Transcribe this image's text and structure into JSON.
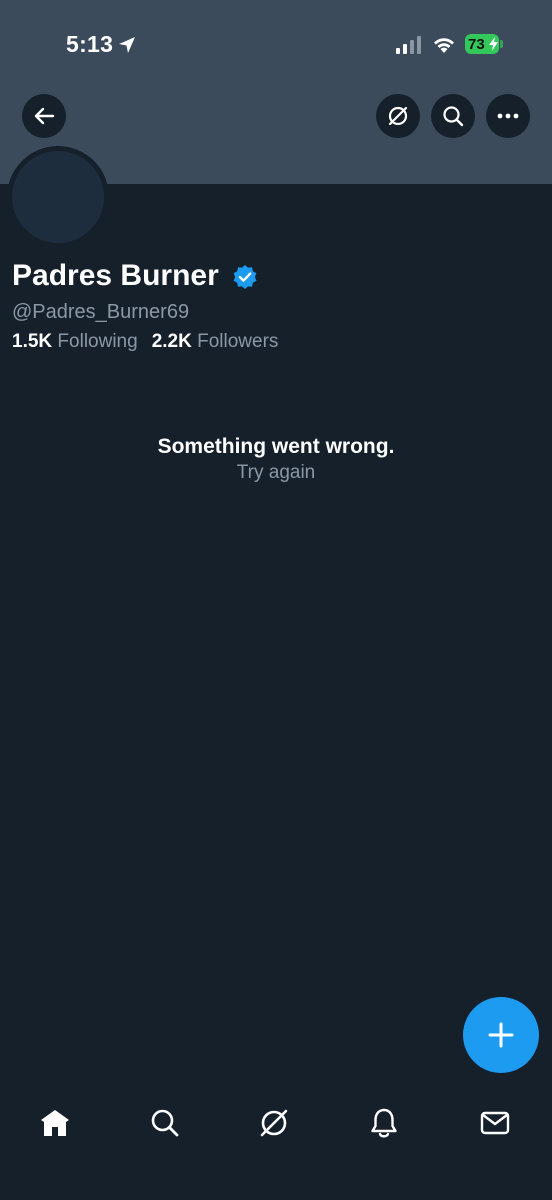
{
  "status_bar": {
    "time": "5:13",
    "battery": "73",
    "battery_color": "#34c759"
  },
  "header": {
    "back_icon": "arrow-left-icon",
    "grok_icon": "grok-icon",
    "search_icon": "search-icon",
    "more_icon": "more-horizontal-icon",
    "banner_color": "#3b4b5b"
  },
  "profile": {
    "display_name": "Padres Burner",
    "verified": true,
    "handle": "@Padres_Burner69",
    "following_count": "1.5K",
    "following_label": "Following",
    "followers_count": "2.2K",
    "followers_label": "Followers"
  },
  "error": {
    "title": "Something went wrong.",
    "retry_label": "Try again"
  },
  "fab": {
    "icon": "plus-icon",
    "color": "#1d9bf0"
  },
  "tab_bar": {
    "tabs": [
      {
        "icon": "home-icon",
        "active": true
      },
      {
        "icon": "search-icon"
      },
      {
        "icon": "grok-icon"
      },
      {
        "icon": "bell-icon"
      },
      {
        "icon": "mail-icon"
      }
    ]
  }
}
